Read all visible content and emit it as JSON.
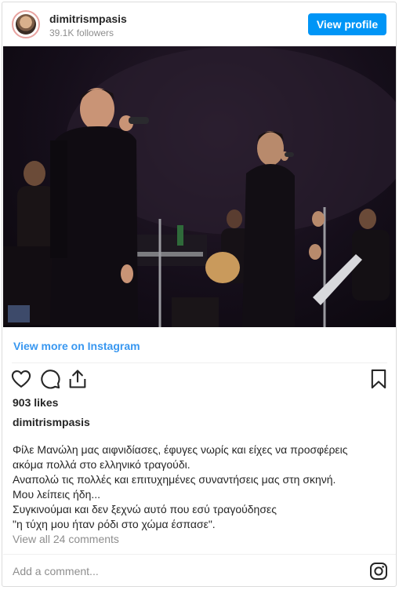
{
  "header": {
    "username": "dimitrismpasis",
    "followers": "39.1K followers",
    "view_profile_label": "View profile"
  },
  "photo": {
    "description_icon": "concert-photo"
  },
  "links": {
    "view_more": "View more on Instagram"
  },
  "actions": {
    "like_icon": "heart-icon",
    "comment_icon": "comment-icon",
    "share_icon": "share-icon",
    "save_icon": "bookmark-icon"
  },
  "likes": "903 likes",
  "caption": {
    "username": "dimitrismpasis",
    "lines": [
      "Φίλε Μανώλη μας αιφνιδίασες, έφυγες νωρίς και είχες να προσφέρεις",
      "ακόμα πολλά στο ελληνικό τραγούδι.",
      "Αναπολώ τις πολλές και επιτυχημένες συναντήσεις μας στη σκηνή.",
      "Μου λείπεις ήδη...",
      "Συγκινούμαι και δεν ξεχνώ αυτό που εσύ τραγούδησες",
      "\"η τύχη μου ήταν ρόδι στο χώμα έσπασε\"."
    ]
  },
  "comments": {
    "view_all": "View all 24 comments",
    "add_placeholder": "Add a comment..."
  },
  "colors": {
    "accent": "#0095f6",
    "link": "#3897f0",
    "muted": "#8e8e8e"
  }
}
